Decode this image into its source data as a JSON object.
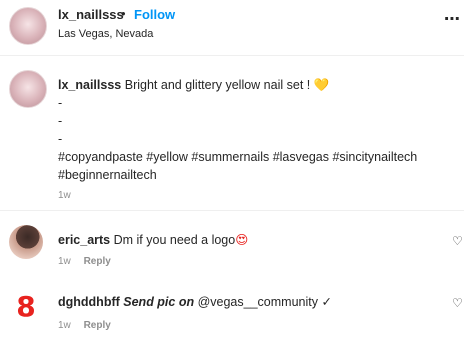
{
  "header": {
    "username": "lx_naillsss",
    "separator": "•",
    "follow_label": "Follow",
    "location": "Las Vegas, Nevada",
    "more_icon": "⋯"
  },
  "caption": {
    "username": "lx_naillsss",
    "text": "Bright and glittery yellow nail set !",
    "emoji": "💛",
    "dash_lines": [
      "-",
      "-",
      "-"
    ],
    "hashtags_line1": "#copyandpaste #yellow #summernails #lasvegas #sincitynailtech",
    "hashtags_line2": "#beginnernailtech",
    "time": "1w"
  },
  "comments": [
    {
      "username": "eric_arts",
      "text": "Dm if you need a logo",
      "emoji": "😍",
      "time": "1w",
      "reply_label": "Reply",
      "heart_icon": "♡"
    },
    {
      "avatar_text": "8",
      "username": "dghddhbff",
      "text_bold": "Send pic on",
      "text_rest": "@vegas__community ✓",
      "time": "1w",
      "reply_label": "Reply",
      "heart_icon": "♡"
    }
  ],
  "colors": {
    "accent": "#0095f6",
    "text": "#262626",
    "muted": "#8e8e8e",
    "avatar_eight": "#e8231f"
  }
}
